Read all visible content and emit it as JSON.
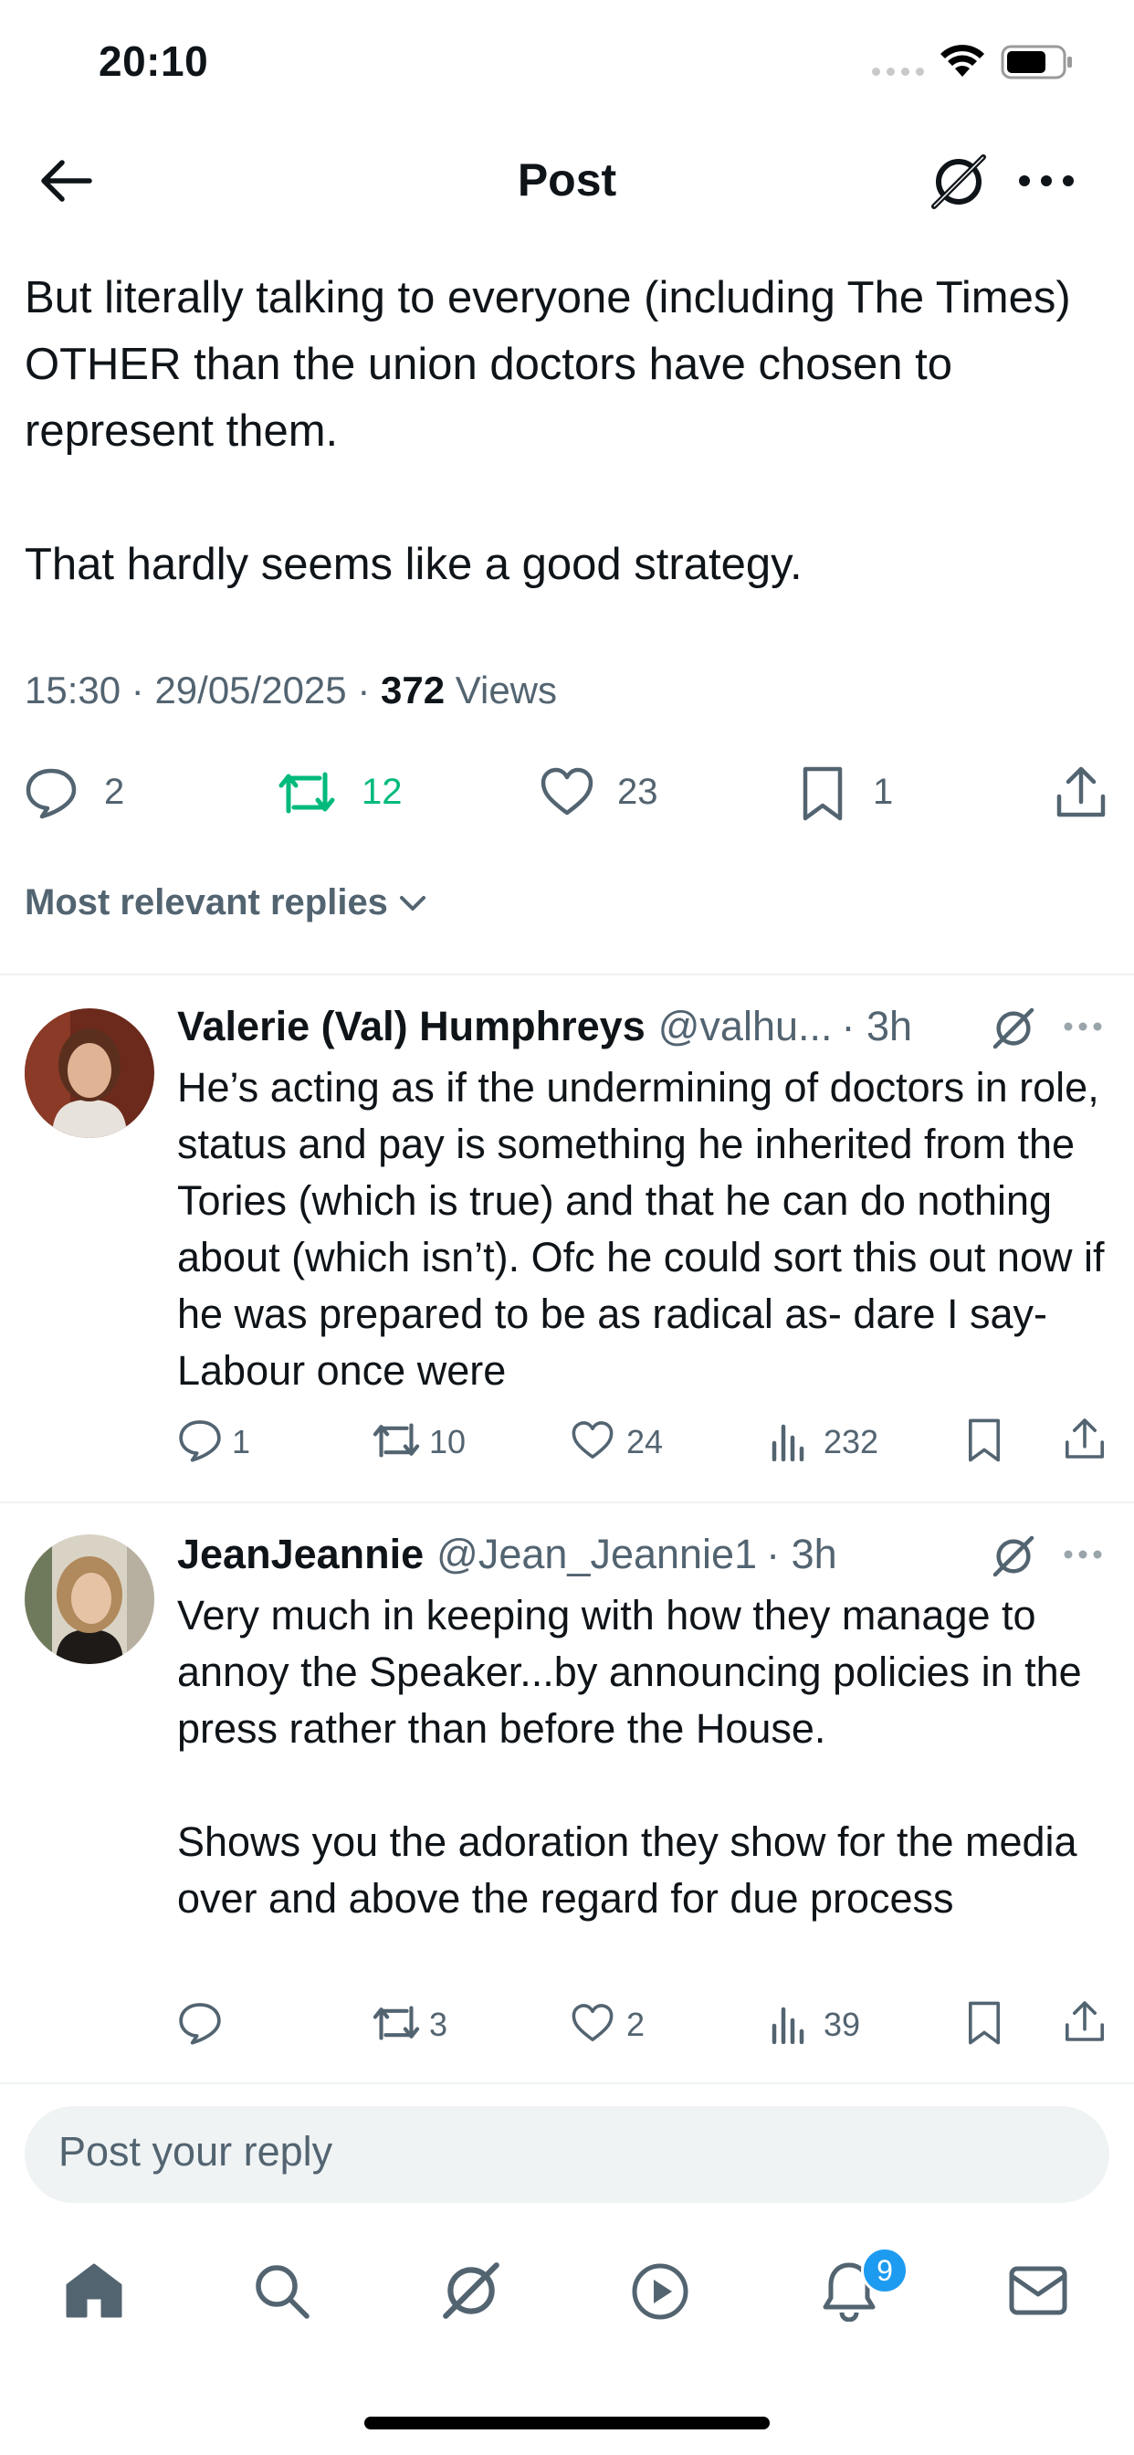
{
  "status_bar": {
    "time": "20:10"
  },
  "header": {
    "title": "Post"
  },
  "post": {
    "text": "But literally talking to everyone (including The Times) OTHER than the union doctors have chosen to represent them.\n\nThat hardly seems like a good strategy.",
    "time": "15:30",
    "date": "29/05/2025",
    "views": "372",
    "views_label": "Views",
    "replies": "2",
    "reposts": "12",
    "likes": "23",
    "bookmarks": "1"
  },
  "sort": {
    "label": "Most relevant replies"
  },
  "replies": [
    {
      "name": "Valerie (Val) Humphreys",
      "handle": "@valhu...",
      "time": "· 3h",
      "text": "He’s acting as if the undermining of doctors in role, status and pay is something he inherited from the Tories (which is true) and that he can do nothing about (which isn’t). Ofc he could sort this out now if he was prepared to be as radical as- dare I say- Labour once were",
      "replies": "1",
      "reposts": "10",
      "likes": "24",
      "views": "232"
    },
    {
      "name": "JeanJeannie",
      "handle": "@Jean_Jeannie1",
      "time": "· 3h",
      "text": "Very much in keeping with how they manage to annoy the Speaker...by announcing policies in the press rather than before the House.\n\nShows you the adoration they show for the media over and above the regard for due process",
      "replies": "",
      "reposts": "3",
      "likes": "2",
      "views": "39"
    }
  ],
  "composer": {
    "placeholder": "Post your reply"
  },
  "tab_bar": {
    "items": [
      "home-icon",
      "search-icon",
      "grok-icon",
      "video-icon",
      "notifications-icon",
      "messages-icon"
    ],
    "notifications_badge": "9"
  },
  "colors": {
    "accent": "#1d9bf0",
    "repost_active": "#00ba7c",
    "secondary_text": "#536471"
  }
}
